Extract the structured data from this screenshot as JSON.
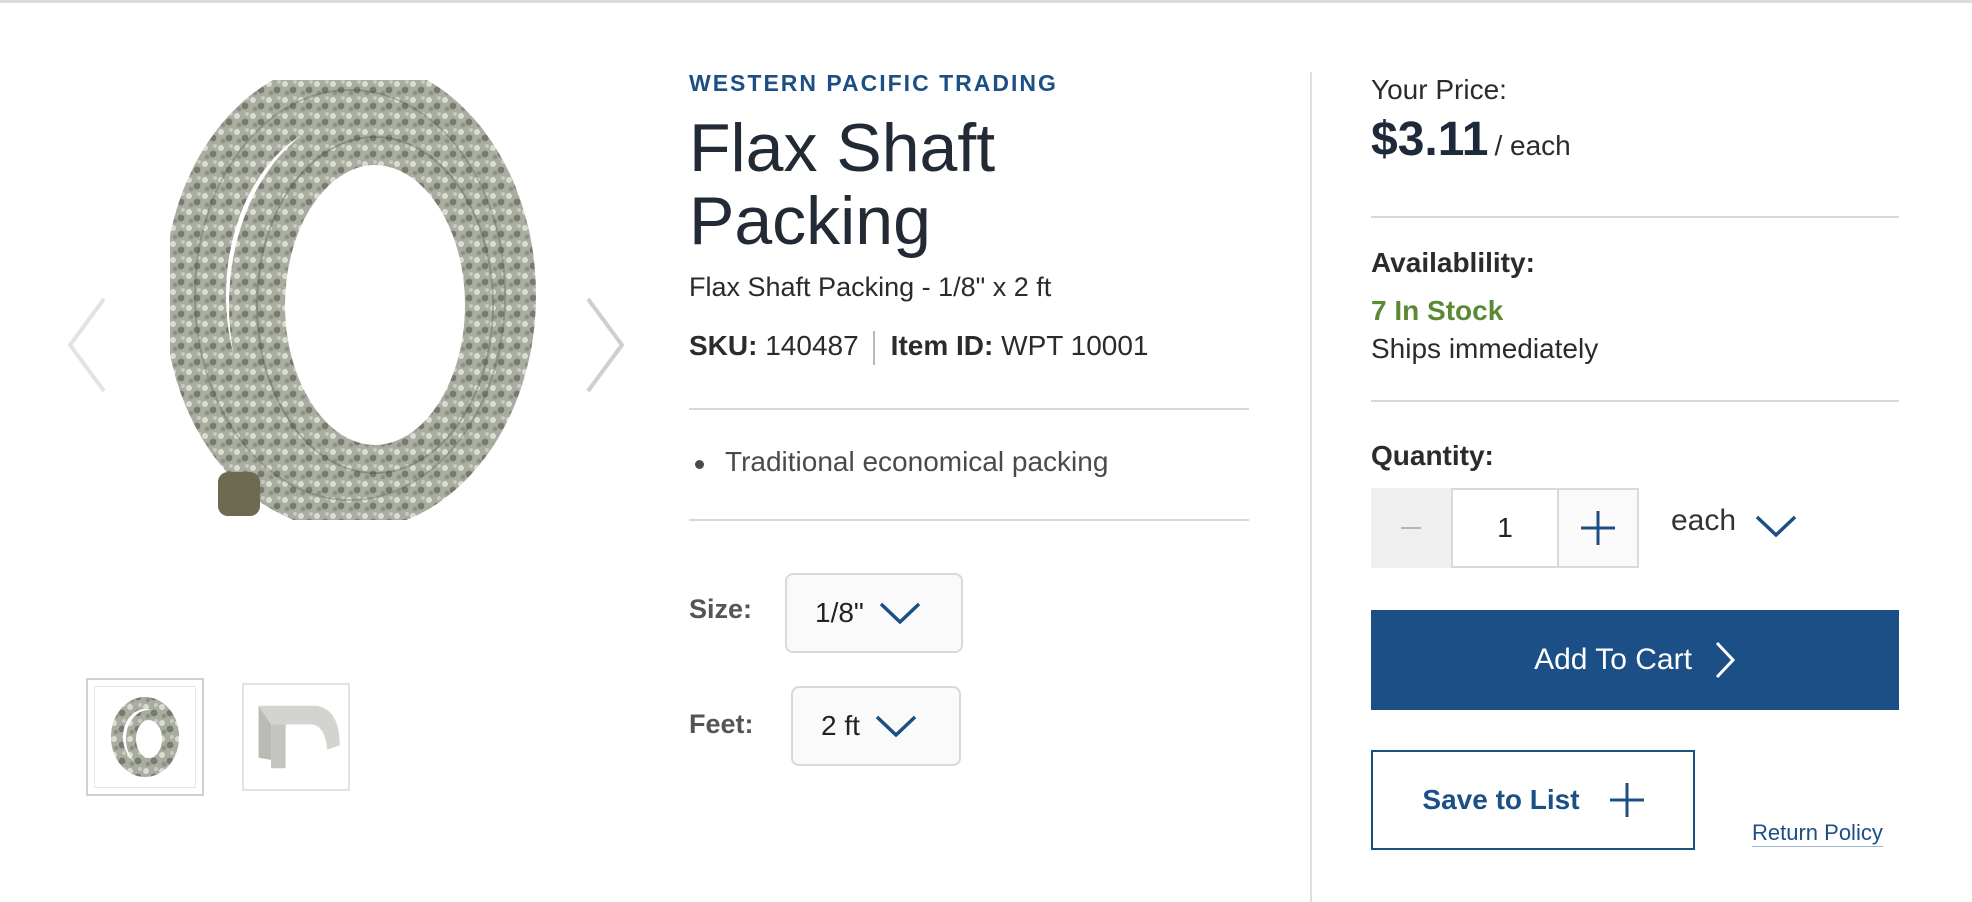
{
  "product": {
    "brand": "WESTERN PACIFIC TRADING",
    "title": "Flax Shaft Packing",
    "subtitle": "Flax Shaft Packing - 1/8\" x 2 ft",
    "sku_label": "SKU:",
    "sku": "140487",
    "item_id_label": "Item ID:",
    "item_id": "WPT 10001",
    "features": [
      "Traditional economical packing"
    ]
  },
  "gallery": {
    "prev_icon": "chevron-left-icon",
    "next_icon": "chevron-right-icon",
    "thumbnail_count": 2,
    "active_thumbnail": 1
  },
  "options": {
    "size": {
      "label": "Size:",
      "value": "1/8\""
    },
    "feet": {
      "label": "Feet:",
      "value": "2 ft"
    }
  },
  "buy_box": {
    "price_label": "Your Price:",
    "price": "$3.11",
    "price_unit": "/ each",
    "availability_label": "Availablility:",
    "stock": "7 In Stock",
    "shipping": "Ships immediately",
    "quantity_label": "Quantity:",
    "quantity": "1",
    "unit": "each",
    "add_to_cart": "Add To Cart",
    "save_to_list": "Save to List",
    "return_policy": "Return Policy"
  },
  "colors": {
    "brand_blue": "#1c4f86",
    "stock_green": "#5b8a35",
    "text_dark": "#222a36"
  }
}
